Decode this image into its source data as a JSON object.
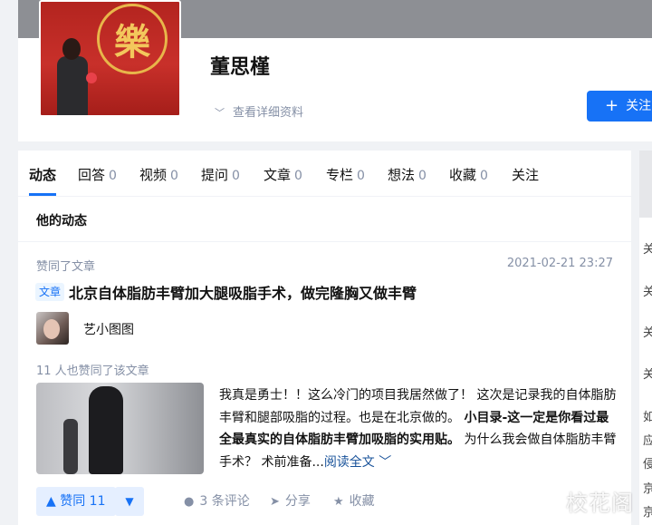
{
  "profile": {
    "name": "董思槿",
    "avatar_seal_char": "樂",
    "detail_link": "查看详细资料",
    "follow_label": "关注"
  },
  "tabs": [
    {
      "label": "动态",
      "count": ""
    },
    {
      "label": "回答",
      "count": "0"
    },
    {
      "label": "视频",
      "count": "0"
    },
    {
      "label": "提问",
      "count": "0"
    },
    {
      "label": "文章",
      "count": "0"
    },
    {
      "label": "专栏",
      "count": "0"
    },
    {
      "label": "想法",
      "count": "0"
    },
    {
      "label": "收藏",
      "count": "0"
    },
    {
      "label": "关注",
      "count": ""
    }
  ],
  "section_title": "他的动态",
  "feed_item": {
    "action": "赞同了文章",
    "time": "2021-02-21 23:27",
    "type_tag": "文章",
    "title": "北京自体脂肪丰臂加大腿吸脂手术，做完隆胸又做丰臂",
    "author": "艺小图图",
    "upvoted_text": "11 人也赞同了该文章",
    "excerpt_1": "我真是勇士！！这么冷门的项目我居然做了！ 这次是记录我的自体脂肪丰臂和腿部吸脂的过程。也是在北京做的。",
    "excerpt_bold": "小目录-这一定是你看过最全最真实的自体脂肪丰臂加吸脂的实用贴。",
    "excerpt_2": " 为什么我会做自体脂肪丰臂手术？ 术前准备...",
    "read_more": "阅读全文",
    "vote_up": "赞同 11",
    "comments": "3 条评论",
    "share": "分享",
    "collect": "收藏"
  },
  "right_column_chars": [
    "关",
    "关",
    "关",
    "关",
    "如",
    "应",
    "侵",
    "京",
    "京"
  ],
  "watermark": "校花阁",
  "colors": {
    "accent": "#1772f6",
    "muted": "#8590a6",
    "link": "#175199"
  },
  "icons": [
    "plus-icon",
    "chevron-down-icon",
    "triangle-up-icon",
    "triangle-down-icon",
    "comment-icon",
    "share-icon",
    "star-icon"
  ]
}
